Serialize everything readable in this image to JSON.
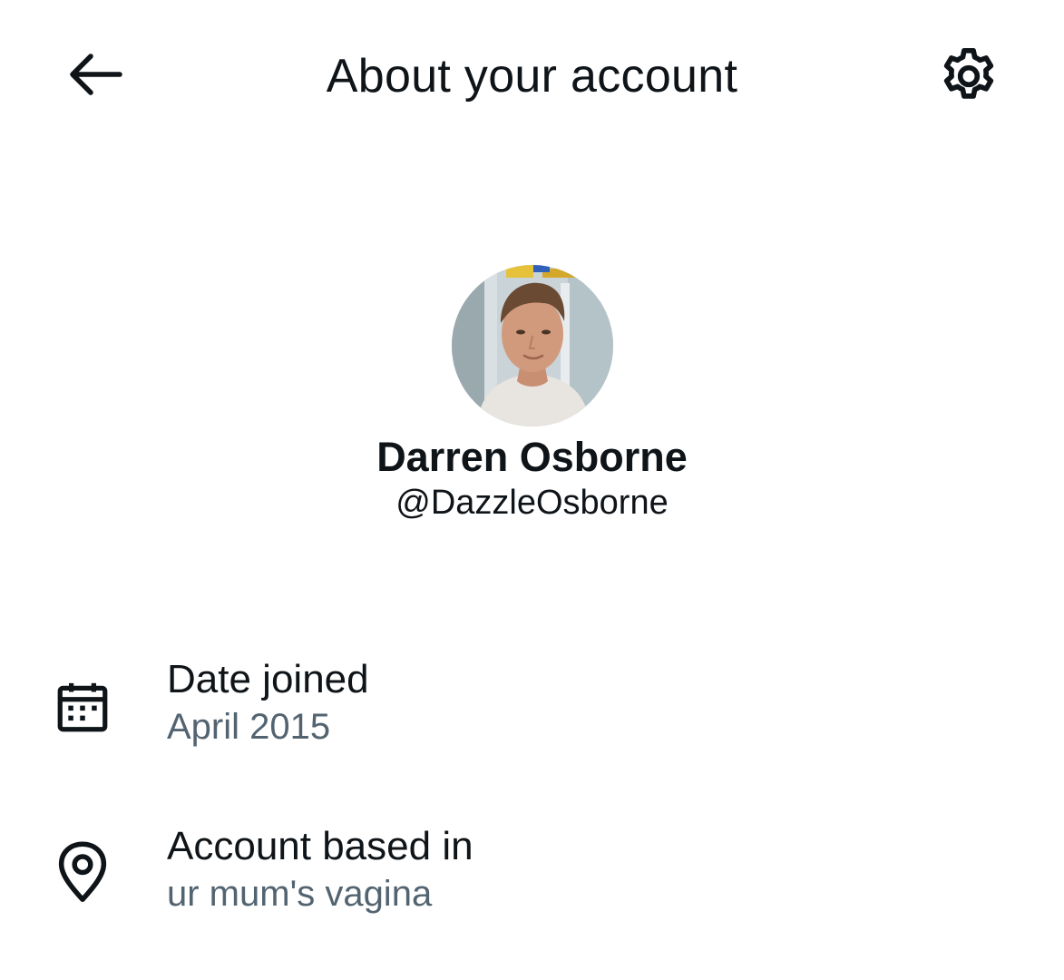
{
  "header": {
    "title": "About your account",
    "back_icon": "arrow-left-icon",
    "settings_icon": "gear-icon"
  },
  "profile": {
    "display_name": "Darren Osborne",
    "handle": "@DazzleOsborne",
    "avatar_icon": "profile-photo"
  },
  "details": [
    {
      "icon": "calendar-icon",
      "label": "Date joined",
      "value": "April 2015"
    },
    {
      "icon": "location-pin-icon",
      "label": "Account based in",
      "value": "ur mum's vagina"
    }
  ],
  "colors": {
    "text_primary": "#0f1419",
    "text_secondary": "#536471",
    "background": "#ffffff"
  }
}
